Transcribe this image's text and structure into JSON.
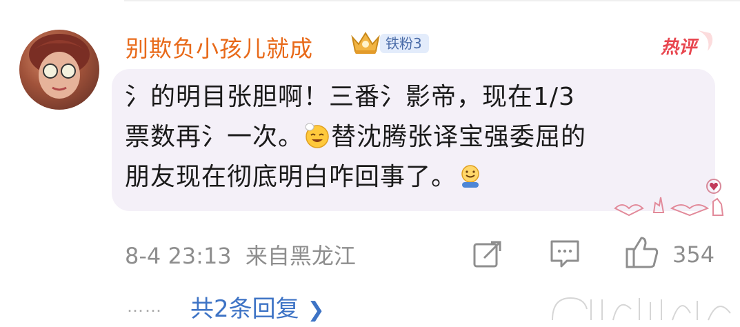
{
  "comment": {
    "username": "别欺负小孩儿就成",
    "fan_badge": "铁粉3",
    "hot_label": "热评",
    "lines": [
      "氵的明目张胆啊！三番氵影帝，现在1/3",
      "票数再氵一次。",
      "替沈腾张译宝强委屈的",
      "朋友现在彻底明白咋回事了。"
    ],
    "timestamp": "8-4 23:13",
    "location": "来自黑龙江",
    "like_count": "354",
    "reply_link": "共2条回复",
    "dots": "……",
    "icons": {
      "share": "share-icon",
      "comment": "comment-icon",
      "like": "thumbs-up-icon",
      "chevron": "chevron-right-icon"
    }
  },
  "colors": {
    "username": "#e86a1a",
    "badge_bg": "#e3ecfb",
    "badge_text": "#4a6ca8",
    "hot": "#e8464f",
    "bubble_bg": "#f4f0f8",
    "meta": "#8e8e8e",
    "link": "#3d73c5"
  }
}
